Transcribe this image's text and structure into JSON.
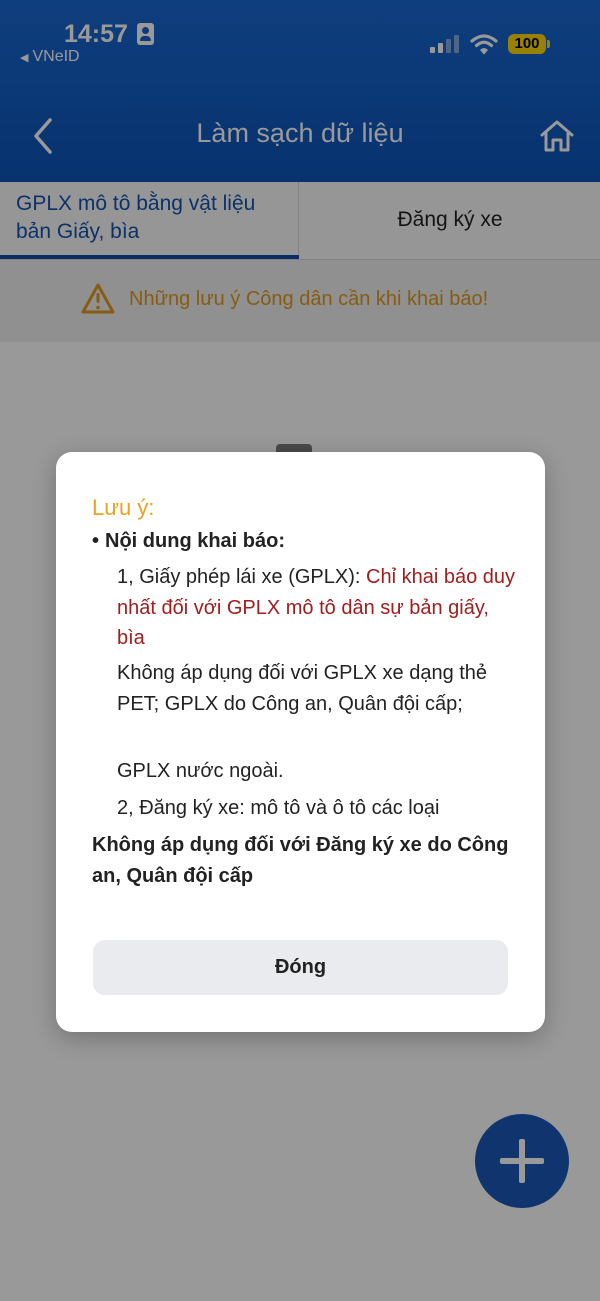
{
  "status_bar": {
    "time": "14:57",
    "back_app": "VNeID",
    "battery": "100",
    "colors": {
      "battery": "#ffd60a"
    }
  },
  "header": {
    "title": "Làm sạch dữ liệu",
    "background": "#1660c6",
    "back_icon": "chevron-left-icon",
    "home_icon": "home-icon"
  },
  "tabs": [
    {
      "label": "GPLX mô tô bằng vật liệu bản Giấy, bìa",
      "active": true
    },
    {
      "label": "Đăng ký xe",
      "active": false
    }
  ],
  "banner": {
    "icon": "warning-icon",
    "text": "Những lưu ý Công dân cần khi khai báo!",
    "color": "#e09a1e"
  },
  "modal": {
    "title": "Lưu ý:",
    "bullet": "•",
    "section_heading": "Nội dung khai báo:",
    "item1_prefix": "1, Giấy phép lái xe (GPLX): ",
    "item1_highlight": "Chỉ khai báo duy nhất đối với GPLX mô tô dân sự bản giấy, bìa",
    "item1_note": "Không áp dụng đối với GPLX xe dạng thẻ PET; GPLX do Công an, Quân đội cấp;",
    "item1_note2": "GPLX nước ngoài.",
    "item2": "2, Đăng ký xe: mô tô và ô tô các loại",
    "footer_note": "Không áp dụng đối với Đăng ký xe do Công an, Quân đội cấp",
    "close_label": "Đóng",
    "colors": {
      "title": "#f0a020",
      "highlight": "#a61b1b"
    }
  },
  "fab": {
    "icon": "plus-icon",
    "color": "#1b59b7"
  }
}
